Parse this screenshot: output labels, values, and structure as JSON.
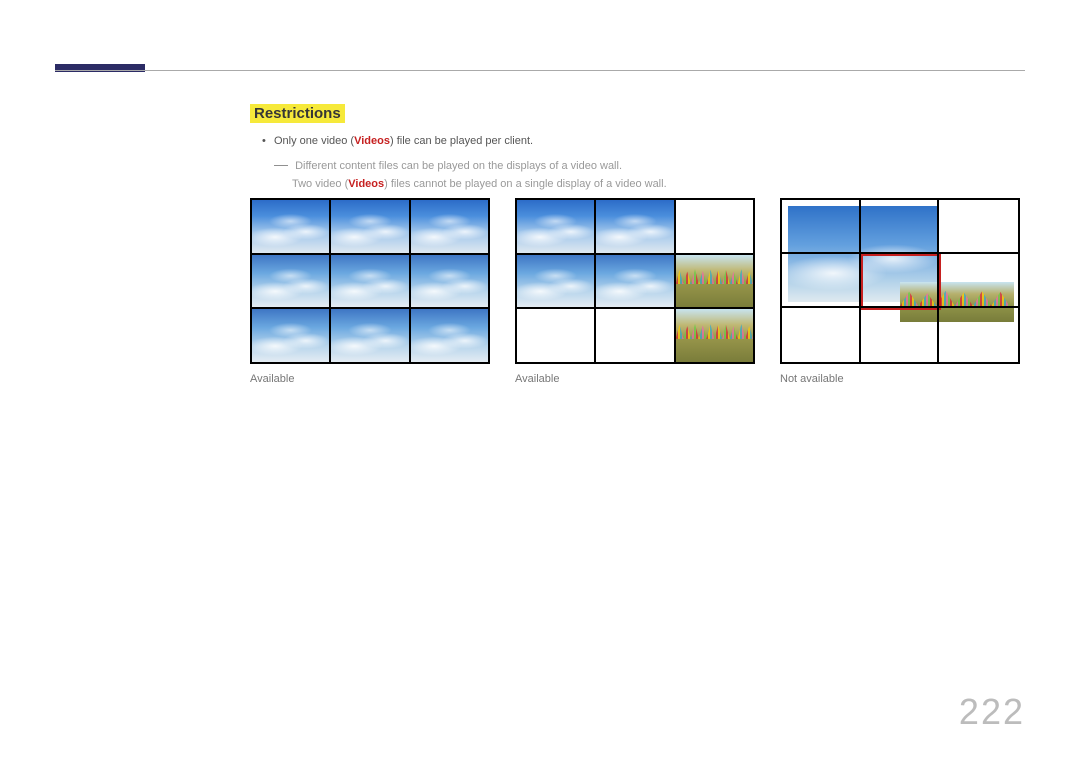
{
  "heading": "Restrictions",
  "bullet1_prefix": "Only one video (",
  "videos_word": "Videos",
  "bullet1_suffix": ") file can be played per client.",
  "sub1": "Different content files can be played on the displays of a video wall.",
  "sub2_prefix": "Two video (",
  "sub2_suffix": ") files cannot be played on a single display of a video wall.",
  "examples": {
    "left": {
      "caption": "Available"
    },
    "middle": {
      "caption": "Available"
    },
    "right": {
      "caption": "Not available"
    }
  },
  "page_number": "222"
}
